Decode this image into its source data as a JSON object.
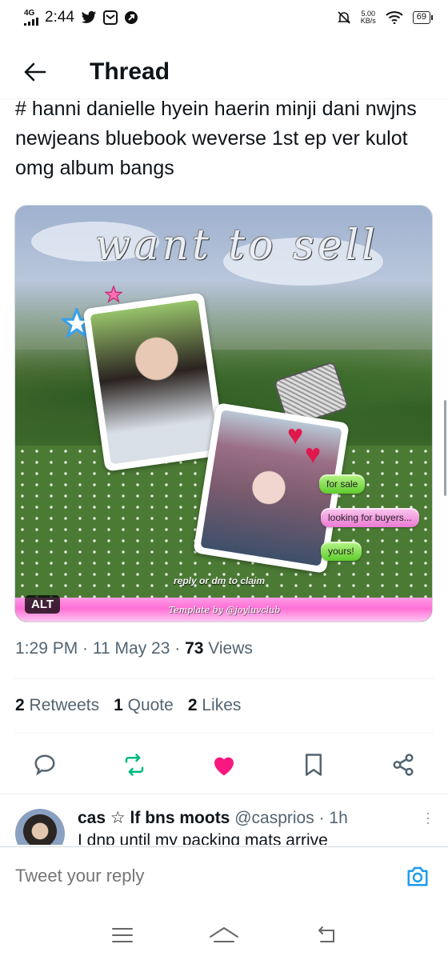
{
  "status_bar": {
    "network": "4G",
    "time": "2:44",
    "speed_value": "5.00",
    "speed_unit": "KB/s",
    "battery": "69",
    "icons": [
      "signal-icon",
      "twitter-icon",
      "gallery-icon",
      "notification-icon",
      "mute-icon",
      "wifi-icon",
      "battery-icon"
    ]
  },
  "header": {
    "title": "Thread"
  },
  "tweet": {
    "text": "# hanni danielle hyein haerin minji dani nwjns newjeans bluebook weverse 1st ep ver kulot omg album bangs",
    "media": {
      "headline": "want to sell",
      "tags": [
        "for sale",
        "looking for buyers...",
        "yours!"
      ],
      "claim_text": "reply or dm to claim",
      "credit": "Template by @joyluvclub",
      "alt_label": "ALT"
    },
    "meta": {
      "time": "1:29 PM",
      "date": "11 May 23",
      "views_count": "73",
      "views_label": "Views"
    },
    "stats": {
      "retweets_count": "2",
      "retweets_label": "Retweets",
      "quotes_count": "1",
      "quotes_label": "Quote",
      "likes_count": "2",
      "likes_label": "Likes"
    },
    "colors": {
      "retweet": "#00ba7c",
      "like": "#f91880",
      "secondary": "#536471",
      "accent": "#1d9bf0"
    }
  },
  "reply_preview": {
    "name": "cas ☆ lf bns moots",
    "handle": "@casprios",
    "time": "1h",
    "text": "I dnp until my packing mats arrive"
  },
  "composer": {
    "placeholder": "Tweet your reply"
  }
}
